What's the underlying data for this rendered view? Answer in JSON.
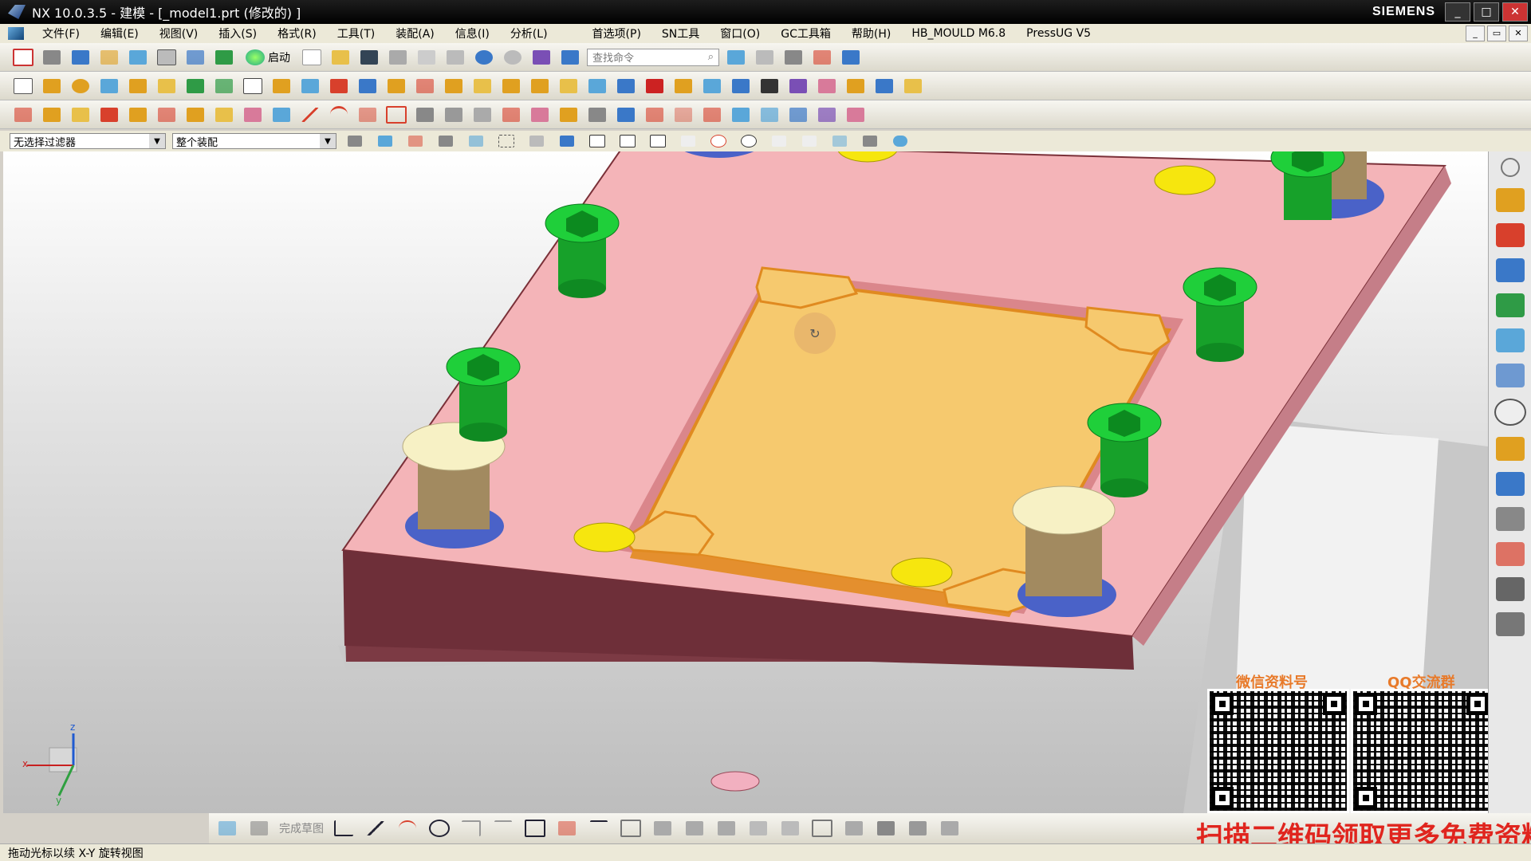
{
  "title": {
    "text": "NX 10.0.3.5 - 建模 - [_model1.prt  (修改的) ]",
    "brand": "SIEMENS"
  },
  "menu": {
    "items": [
      "文件(F)",
      "编辑(E)",
      "视图(V)",
      "插入(S)",
      "格式(R)",
      "工具(T)",
      "装配(A)",
      "信息(I)",
      "分析(L)",
      "首选项(P)",
      "SN工具",
      "窗口(O)",
      "GC工具箱",
      "帮助(H)",
      "HB_MOULD M6.8",
      "PressUG V5"
    ]
  },
  "toolbar": {
    "start_label": "启动",
    "search_placeholder": "查找命令"
  },
  "filter": {
    "selection_filter": "无选择过滤器",
    "assembly_scope": "整个装配"
  },
  "sketch": {
    "finish_label": "完成草图"
  },
  "status": {
    "text": "拖动光标以续 X-Y 旋转视图"
  },
  "watermark": {
    "wechat_label": "微信资料号",
    "qq_label": "QQ交流群",
    "banner": "扫描二维码领取更多免费资料"
  },
  "icons": {
    "colors": [
      "#3a78c8",
      "#e0a020",
      "#d8402c",
      "#2f9b46",
      "#7a4fb5",
      "#5aa7d9"
    ]
  }
}
